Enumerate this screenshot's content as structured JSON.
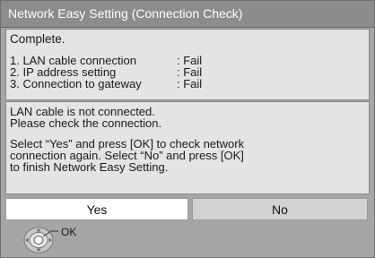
{
  "window": {
    "title": "Network Easy Setting (Connection Check)"
  },
  "status": {
    "text": "Complete."
  },
  "checks": [
    {
      "label": "1. LAN cable connection",
      "result": ": Fail"
    },
    {
      "label": "2. IP address setting",
      "result": ": Fail"
    },
    {
      "label": "3. Connection to gateway",
      "result": ": Fail"
    }
  ],
  "message": {
    "line1": "LAN cable is not connected.",
    "line2": "Please check the connection.",
    "line3": "Select “Yes” and press [OK] to check network",
    "line4": "connection again. Select “No” and press [OK]",
    "line5": "to finish Network Easy Setting."
  },
  "buttons": {
    "yes_label": "Yes",
    "no_label": "No",
    "selected": "Yes"
  },
  "hint": {
    "icon": "remote-dpad-icon",
    "label": "OK"
  },
  "colors": {
    "title_bar": "#8c8c8c",
    "panel": "#e4e4e4",
    "background": "#a6a6a6",
    "selected_button": "#ffffff",
    "unselected_button": "#d2d2d2"
  }
}
